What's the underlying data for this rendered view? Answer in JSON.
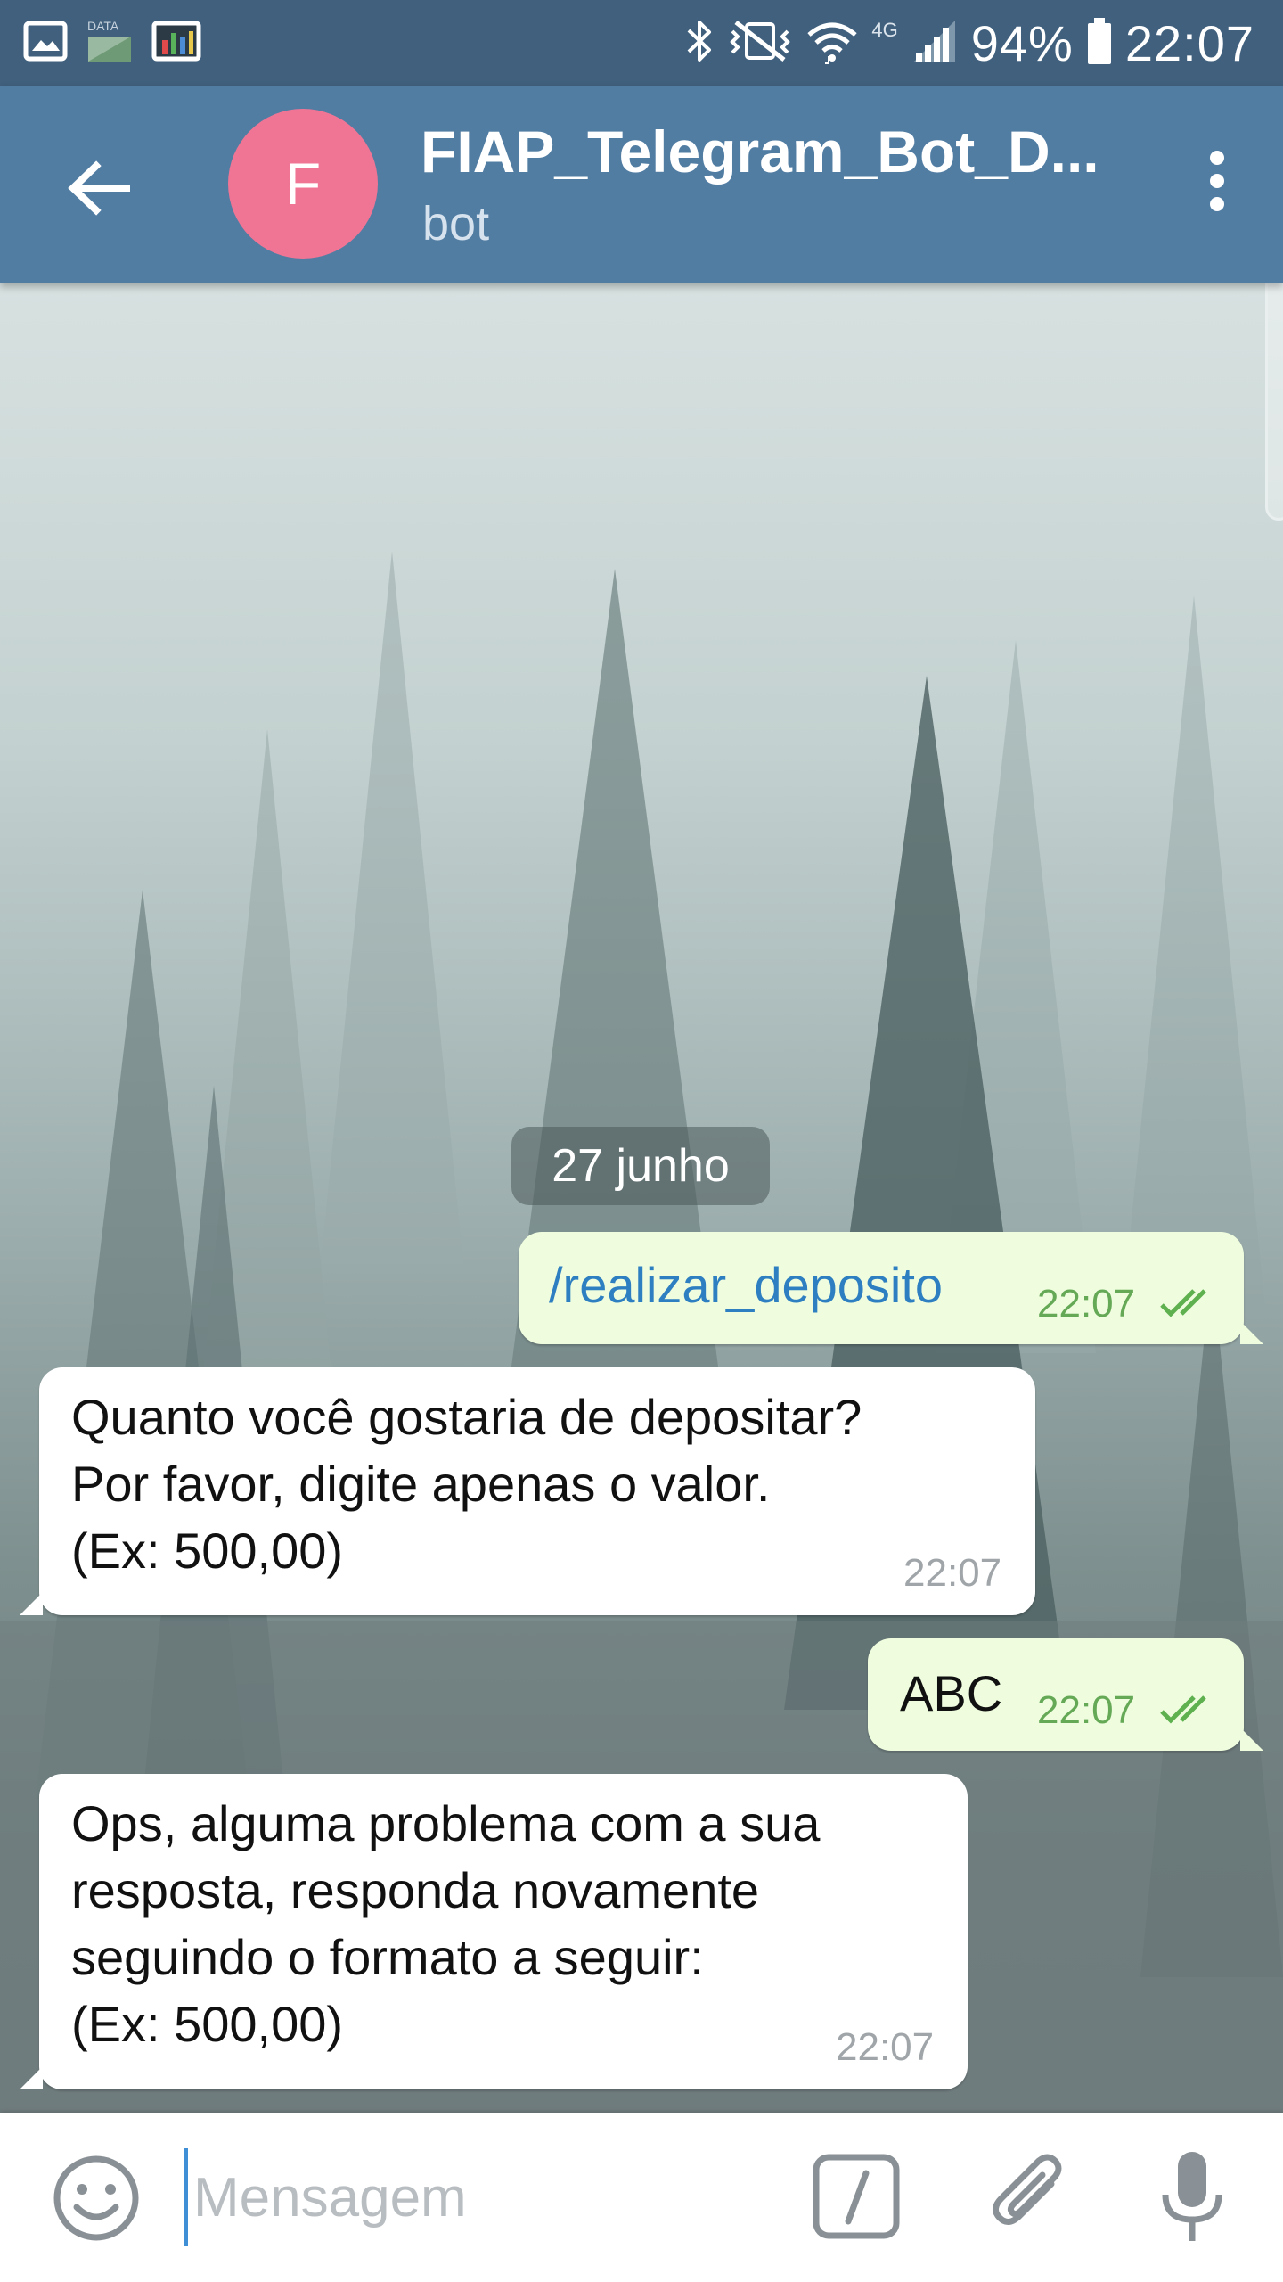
{
  "status_bar": {
    "network_type": "4G",
    "data_label": "DATA",
    "battery": "94%",
    "time": "22:07"
  },
  "header": {
    "avatar_letter": "F",
    "title": "FIAP_Telegram_Bot_D...",
    "subtitle": "bot",
    "accent_color": "#527da3",
    "avatar_color": "#f07595"
  },
  "chat": {
    "date_chip": "27 junho",
    "messages": [
      {
        "direction": "outgoing",
        "text": "/realizar_deposito",
        "time": "22:07",
        "status": "read"
      },
      {
        "direction": "incoming",
        "lines": [
          "Quanto você gostaria de depositar?",
          "Por favor, digite apenas o valor.",
          "(Ex: 500,00)"
        ],
        "time": "22:07"
      },
      {
        "direction": "outgoing",
        "text": "ABC",
        "time": "22:07",
        "status": "read"
      },
      {
        "direction": "incoming",
        "lines": [
          "Ops, alguma problema com a sua",
          "resposta, responda novamente",
          "seguindo o formato a seguir:",
          "(Ex: 500,00)"
        ],
        "time": "22:07"
      }
    ]
  },
  "input_bar": {
    "placeholder": "Mensagem",
    "value": ""
  },
  "icons": {
    "status_left": [
      "image-icon",
      "data-icon",
      "activity-monitor-icon"
    ],
    "status_right": [
      "bluetooth-icon",
      "mute-vibrate-icon",
      "wifi-icon",
      "signal-icon",
      "battery-icon"
    ],
    "header": [
      "back-arrow-icon",
      "more-vert-icon"
    ],
    "input": [
      "emoji-icon",
      "bot-command-icon",
      "attach-icon",
      "mic-icon"
    ]
  }
}
